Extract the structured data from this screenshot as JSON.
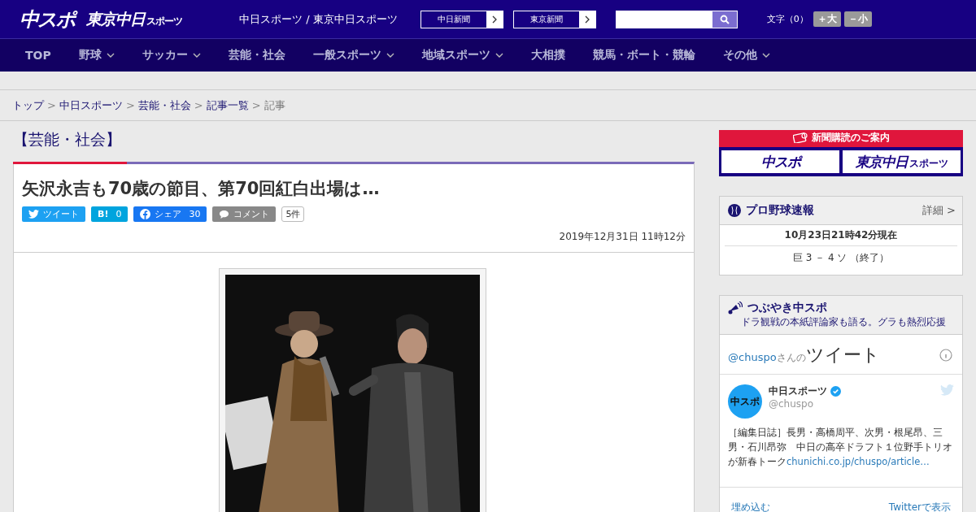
{
  "header": {
    "logo_main": "中スポ",
    "logo_sub": "東京中日",
    "logo_sub_small": "スポーツ",
    "site_title": "中日スポーツ / 東京中日スポーツ",
    "paper_links": [
      "中日新聞",
      "東京新聞"
    ],
    "font_size": {
      "label": "文字（0）",
      "buttons": [
        "＋大",
        "－小"
      ]
    }
  },
  "nav": [
    {
      "label": "TOP",
      "has_menu": false
    },
    {
      "label": "野球",
      "has_menu": true
    },
    {
      "label": "サッカー",
      "has_menu": true
    },
    {
      "label": "芸能・社会",
      "has_menu": false
    },
    {
      "label": "一般スポーツ",
      "has_menu": true
    },
    {
      "label": "地域スポーツ",
      "has_menu": true
    },
    {
      "label": "大相撲",
      "has_menu": false
    },
    {
      "label": "競馬・ボート・競輪",
      "has_menu": false
    },
    {
      "label": "その他",
      "has_menu": true
    }
  ],
  "breadcrumb": [
    {
      "label": "トップ",
      "link": true
    },
    {
      "sep": ">",
      "label": "中日スポーツ",
      "link": true
    },
    {
      "sep": ">",
      "label": "芸能・社会",
      "link": true
    },
    {
      "sep": ">",
      "label": "記事一覧",
      "link": true
    },
    {
      "sep": ">",
      "label": "記事",
      "link": false
    }
  ],
  "article": {
    "category": "【芸能・社会】",
    "title": "矢沢永吉も70歳の節目、第70回紅白出場は…",
    "share": [
      {
        "kind": "twitter",
        "label": "ツイート"
      },
      {
        "kind": "hatena",
        "label": "B!",
        "count": "0"
      },
      {
        "kind": "facebook",
        "label": "シェア",
        "count": "30"
      },
      {
        "kind": "comment",
        "label": "コメント"
      }
    ],
    "comment_count": "5件",
    "date": "2019年12月31日 11時12分"
  },
  "sidebar": {
    "subscribe": {
      "title": "新聞購読のご案内",
      "logos": [
        {
          "main": "中スポ"
        },
        {
          "main": "東京中日",
          "small": "スポーツ"
        }
      ]
    },
    "baseball": {
      "title": "プロ野球速報",
      "more": "詳細 >",
      "time": "10月23日21時42分現在",
      "score": "巨 3 － 4 ソ （終了）"
    },
    "tweets": {
      "title": "つぶやき中スポ",
      "subtitle": "ドラ観戦の本紙評論家も語る。グラも熱烈応援",
      "handle_link": "@chuspo",
      "handle_suffix": "さんの",
      "heading": "ツイート",
      "tweet": {
        "avatar": "中スポ",
        "name": "中日スポーツ",
        "verified": true,
        "handle": "@chuspo",
        "text": "［編集日誌］長男・高橋周平、次男・根尾昂、三男・石川昂弥　中日の高卒ドラフト１位野手トリオが新春トーク",
        "link": "chunichi.co.jp/chuspo/article…"
      },
      "footer": [
        "埋め込む",
        "Twitterで表示"
      ]
    }
  }
}
